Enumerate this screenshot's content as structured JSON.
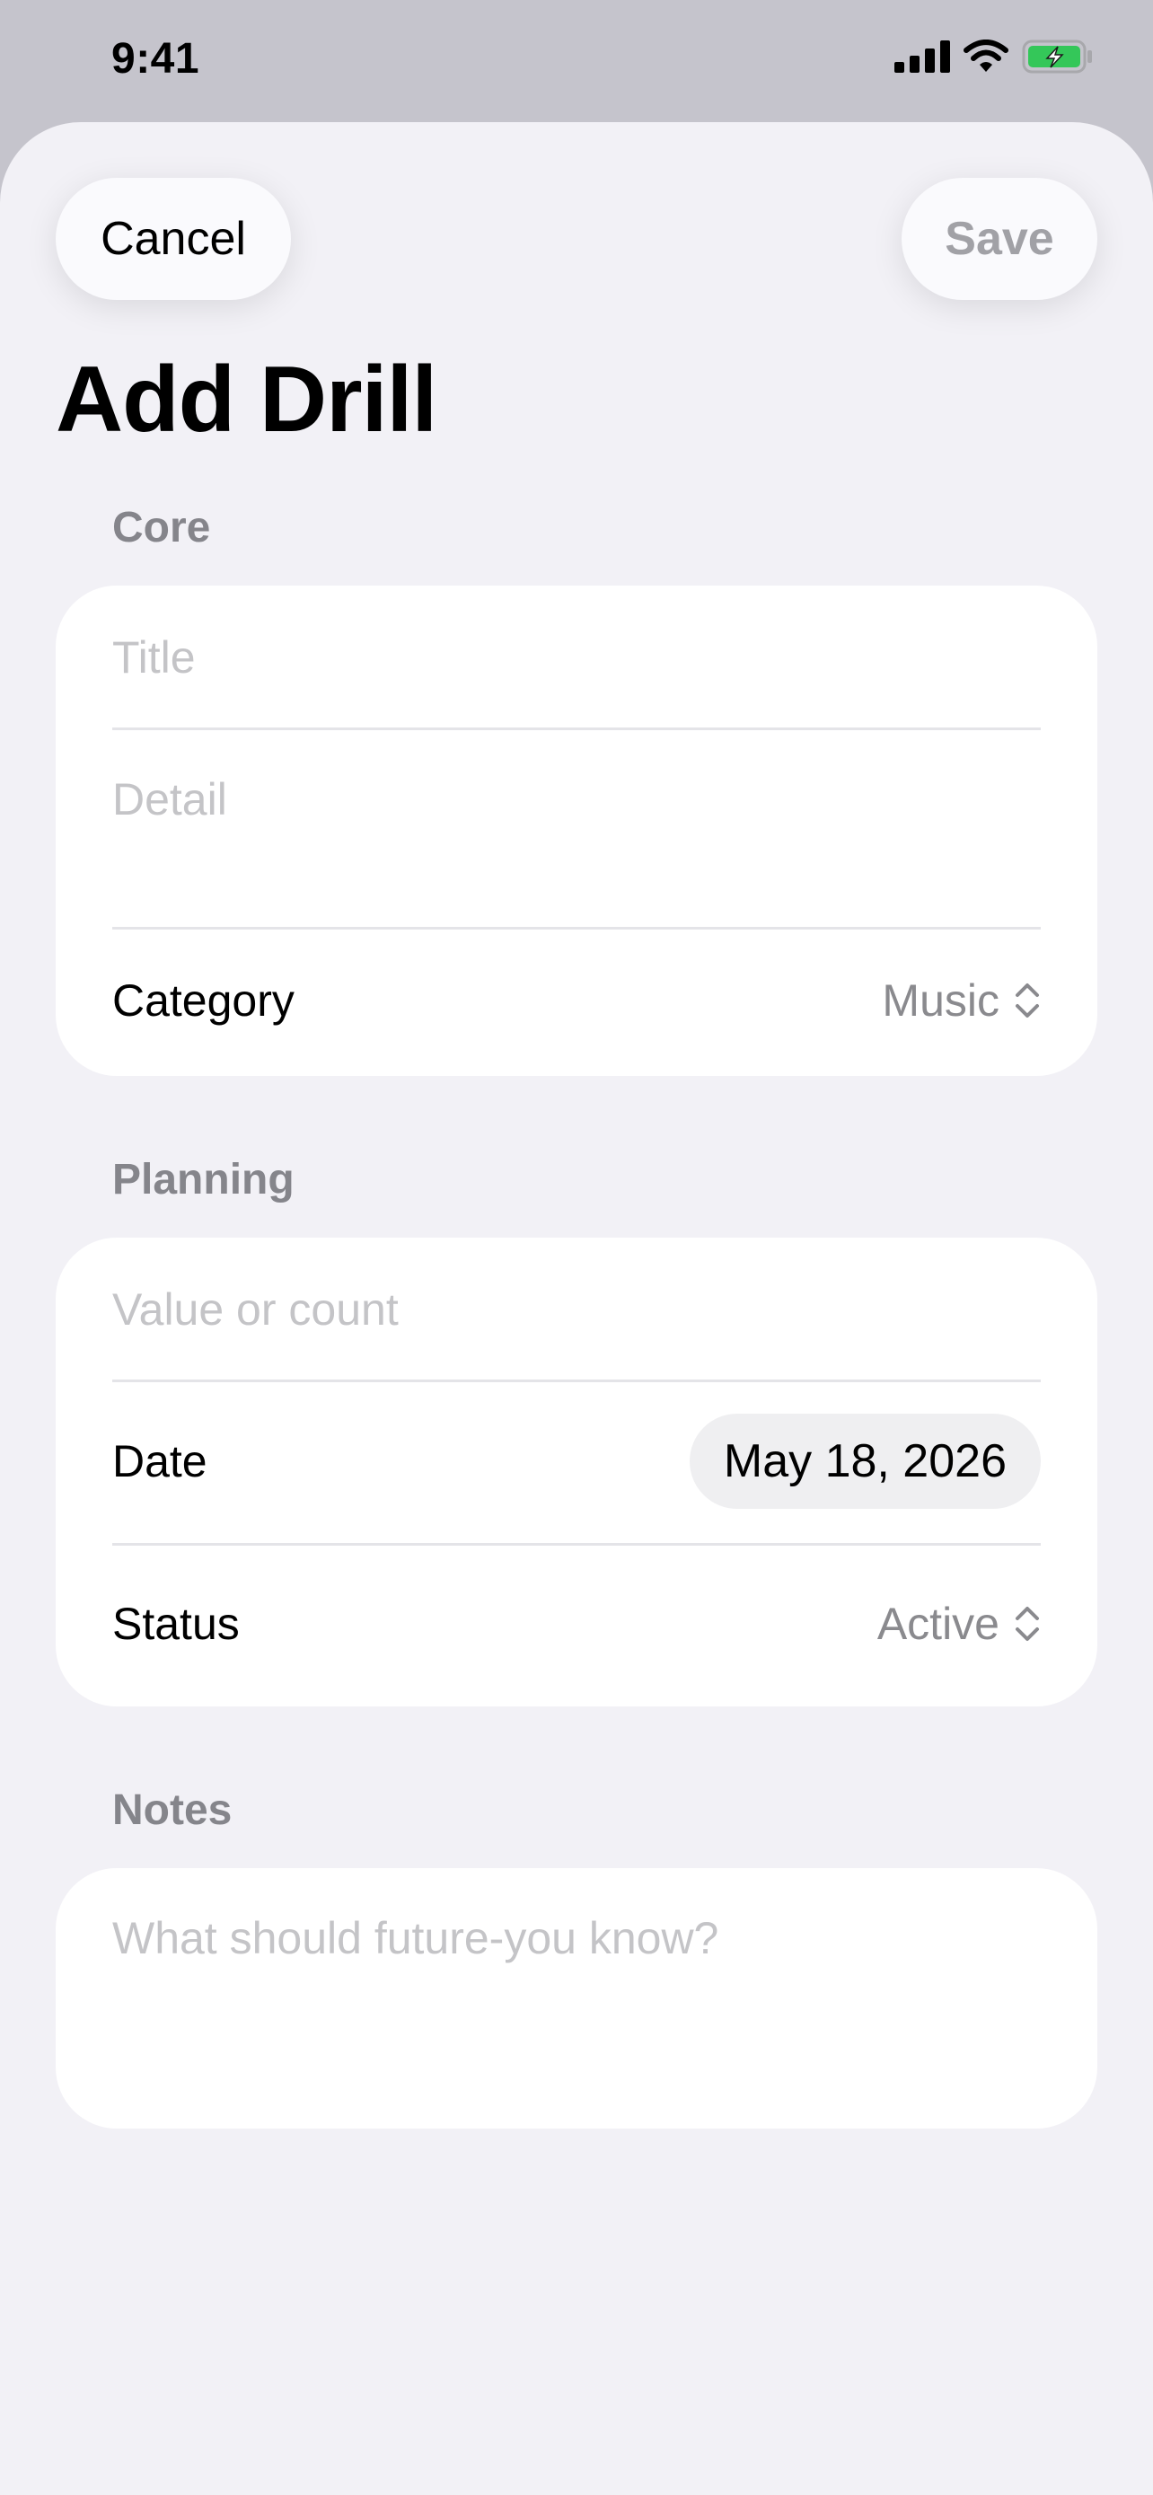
{
  "status_bar": {
    "time": "9:41"
  },
  "header": {
    "cancel_label": "Cancel",
    "save_label": "Save",
    "title": "Add Drill"
  },
  "sections": {
    "core": {
      "header": "Core",
      "title_placeholder": "Title",
      "detail_placeholder": "Detail",
      "category_label": "Category",
      "category_value": "Music"
    },
    "planning": {
      "header": "Planning",
      "value_placeholder": "Value or count",
      "date_label": "Date",
      "date_value": "May 18, 2026",
      "status_label": "Status",
      "status_value": "Active"
    },
    "notes": {
      "header": "Notes",
      "notes_placeholder": "What should future-you know?"
    }
  },
  "colors": {
    "sheet_background": "#f2f1f6",
    "dimmed_background": "#c5c4cc",
    "card_background": "#ffffff",
    "battery_green": "#34c759",
    "disabled_text": "#a1a1a6"
  },
  "icons": {
    "signal": "cellular-signal-icon",
    "wifi": "wifi-icon",
    "battery": "battery-charging-icon",
    "picker": "chevron-up-down-icon"
  }
}
